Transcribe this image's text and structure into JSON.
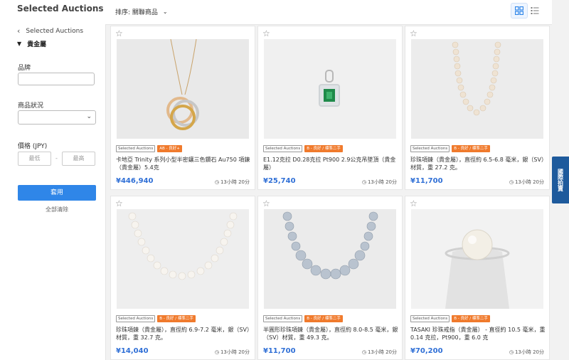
{
  "sidebar": {
    "title": "Selected Auctions",
    "back_link": "Selected Auctions",
    "current_category": "貴金屬",
    "brand_label": "品牌",
    "brand_value": "",
    "condition_label": "商品狀況",
    "condition_value": "",
    "price_label": "價格 (JPY)",
    "price_min_placeholder": "最低",
    "price_max_placeholder": "最高",
    "price_separator": "-",
    "apply_label": "套用",
    "clear_label": "全部清除"
  },
  "topbar": {
    "sort_label": "排序: 關聯商品",
    "view_modes": [
      "grid-view-icon",
      "list-view-icon"
    ],
    "active_view": "grid"
  },
  "feedback_tab": "國際拍賣",
  "colors": {
    "accent": "#2f86e8",
    "price": "#2f6fd6",
    "condition_tag": "#f07a2c",
    "feedback": "#1e5a9c"
  },
  "products": [
    {
      "seller_tag": "Selected Auctions",
      "condition_tag": "AB - 良好+",
      "title": "卡地亞 Trinity 系列小型半密鑲三色鑽石 Au750 項鍊（貴金屬）5.4克",
      "price": "¥446,940",
      "time_left": "13小時 20分",
      "image": "three-ring-gold-pendant-necklace"
    },
    {
      "seller_tag": "Selected Auctions",
      "condition_tag": "B - 良好 / 標準二手",
      "title": "E1.12克拉 D0.28克拉 Pt900 2.9公克吊墜頂（貴金屬）",
      "price": "¥25,740",
      "time_left": "13小時 20分",
      "image": "emerald-diamond-pendant"
    },
    {
      "seller_tag": "Selected Auctions",
      "condition_tag": "B - 良好 / 標準二手",
      "title": "珍珠項鍊（貴金屬），直徑約 6.5-6.8 毫米，銀（SV）材質，重 27.2 克。",
      "price": "¥11,700",
      "time_left": "13小時 20分",
      "image": "pearl-necklace"
    },
    {
      "seller_tag": "Selected Auctions",
      "condition_tag": "B - 良好 / 標準二手",
      "title": "珍珠項鍊（貴金屬），直徑約 6.9-7.2 毫米，銀（SV）材質，重 32.7 克。",
      "price": "¥14,040",
      "time_left": "13小時 20分",
      "image": "white-pearl-necklace"
    },
    {
      "seller_tag": "Selected Auctions",
      "condition_tag": "B - 良好 / 標準二手",
      "title": "半圓形珍珠項鍊（貴金屬），直徑約 8.0-8.5 毫米，銀（SV）材質，重 49.3 克。",
      "price": "¥11,700",
      "time_left": "13小時 20分",
      "image": "grey-baroque-pearl-necklace"
    },
    {
      "seller_tag": "Selected Auctions",
      "condition_tag": "B - 良好 / 標準二手",
      "title": "TASAKI 珍珠戒指（貴金屬） - 直徑約 10.5 毫米，重 0.14 克拉，Pt900，重 6.0 克",
      "price": "¥70,200",
      "time_left": "13小時 20分",
      "image": "pearl-ring-on-stand"
    }
  ]
}
